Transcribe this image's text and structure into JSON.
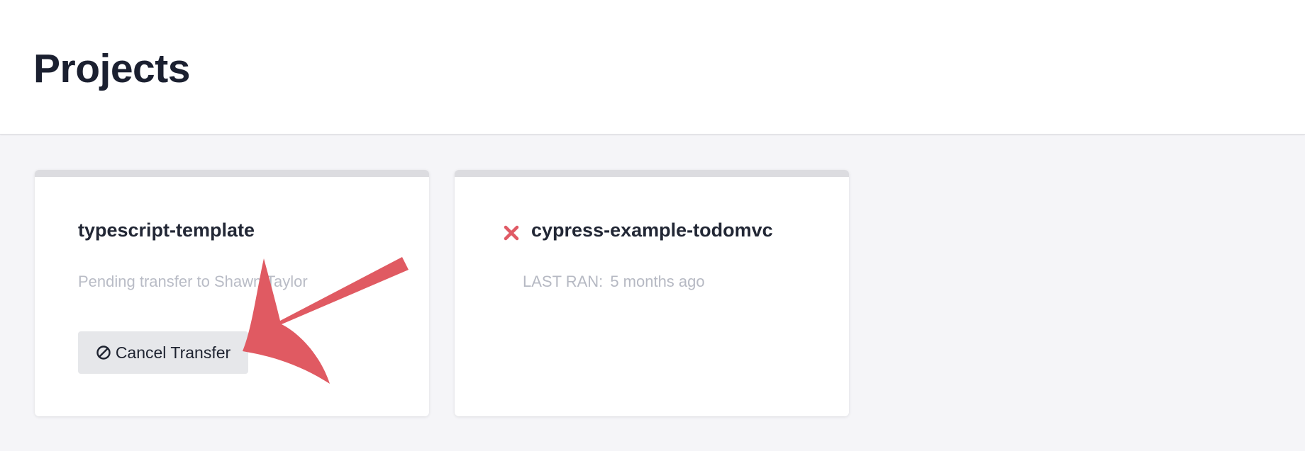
{
  "header": {
    "title": "Projects"
  },
  "projects": [
    {
      "name": "typescript-template",
      "pending_text": "Pending transfer to Shawn Taylor",
      "action_label": "Cancel Transfer",
      "action_icon": "cancel-circle-icon"
    },
    {
      "name": "cypress-example-todomvc",
      "status_icon": "failed-x-icon",
      "last_ran_label": "LAST RAN:",
      "last_ran_value": "5 months ago"
    }
  ],
  "colors": {
    "card_topbar": "#dcdce0",
    "status_failed": "#e05a65",
    "annotation_arrow": "#e05a62"
  }
}
